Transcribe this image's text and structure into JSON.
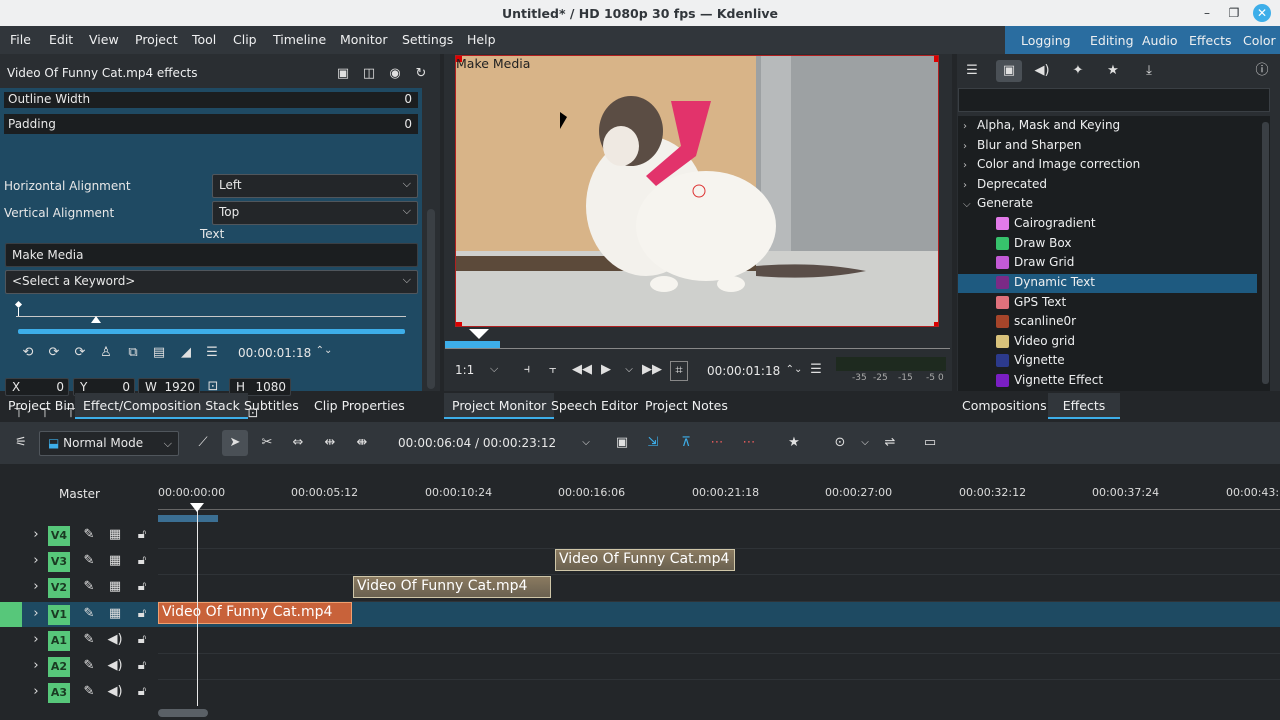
{
  "window": {
    "title": "Untitled* / HD 1080p 30 fps — Kdenlive"
  },
  "menu": [
    "File",
    "Edit",
    "View",
    "Project",
    "Tool",
    "Clip",
    "Timeline",
    "Monitor",
    "Settings",
    "Help"
  ],
  "layouts": [
    "Logging",
    "Editing",
    "Audio",
    "Effects",
    "Color"
  ],
  "effects_panel": {
    "title": "Video Of Funny Cat.mp4 effects",
    "outline_width_label": "Outline Width",
    "outline_width": "0",
    "padding_label": "Padding",
    "padding": "0",
    "h_align_label": "Horizontal Alignment",
    "h_align": "Left",
    "v_align_label": "Vertical Alignment",
    "v_align": "Top",
    "text_label": "Text",
    "text_value": "Make Media",
    "keyword_select": "<Select a Keyword>",
    "timecode": "00:00:01:18",
    "x_label": "X",
    "x": "0",
    "y_label": "Y",
    "y": "0",
    "w_label": "W",
    "w": "1920",
    "h_label": "H",
    "h": "1080"
  },
  "left_tabs": [
    "Project Bin",
    "Effect/Composition Stack",
    "Subtitles",
    "Clip Properties"
  ],
  "monitor": {
    "overlay_text": "Make Media",
    "zoom": "1:1",
    "timecode": "00:00:01:18",
    "meter_labels": [
      "-35",
      "-25",
      "-15",
      "-5",
      "0"
    ],
    "tabs": [
      "Project Monitor",
      "Speech Editor",
      "Project Notes"
    ]
  },
  "effects_list": {
    "categories": [
      "Alpha, Mask and Keying",
      "Blur and Sharpen",
      "Color and Image correction",
      "Deprecated",
      "Generate"
    ],
    "items": [
      {
        "name": "Cairogradient",
        "color": "#e27be9"
      },
      {
        "name": "Draw Box",
        "color": "#37c26c"
      },
      {
        "name": "Draw Grid",
        "color": "#c35ad6"
      },
      {
        "name": "Dynamic Text",
        "color": "#7b2a86"
      },
      {
        "name": "GPS Text",
        "color": "#e0717c"
      },
      {
        "name": "scanline0r",
        "color": "#a6452a"
      },
      {
        "name": "Video grid",
        "color": "#d8c27b"
      },
      {
        "name": "Vignette",
        "color": "#2c3a8c"
      },
      {
        "name": "Vignette Effect",
        "color": "#7a1fc4"
      }
    ],
    "selected": "Dynamic Text",
    "tabs": [
      "Compositions",
      "Effects"
    ]
  },
  "timeline": {
    "mode": "Normal Mode",
    "timecode": "00:00:06:04 / 00:00:23:12",
    "master_label": "Master",
    "ruler": [
      "00:00:00:00",
      "00:00:05:12",
      "00:00:10:24",
      "00:00:16:06",
      "00:00:21:18",
      "00:00:27:00",
      "00:00:32:12",
      "00:00:37:24",
      "00:00:43:"
    ],
    "tracks": [
      "V4",
      "V3",
      "V2",
      "V1",
      "A1",
      "A2",
      "A3"
    ],
    "clips": [
      {
        "track": "V3",
        "name": "Video Of Funny Cat.mp4"
      },
      {
        "track": "V2",
        "name": "Video Of Funny Cat.mp4"
      },
      {
        "track": "V1",
        "name": "Video Of Funny Cat.mp4"
      }
    ]
  },
  "colors": {
    "accent": "#3daee9",
    "layout_bar": "#2a6da0",
    "track_label": "#57c77a",
    "clip_v1": "#c8623a",
    "selection": "#1e5a80"
  }
}
